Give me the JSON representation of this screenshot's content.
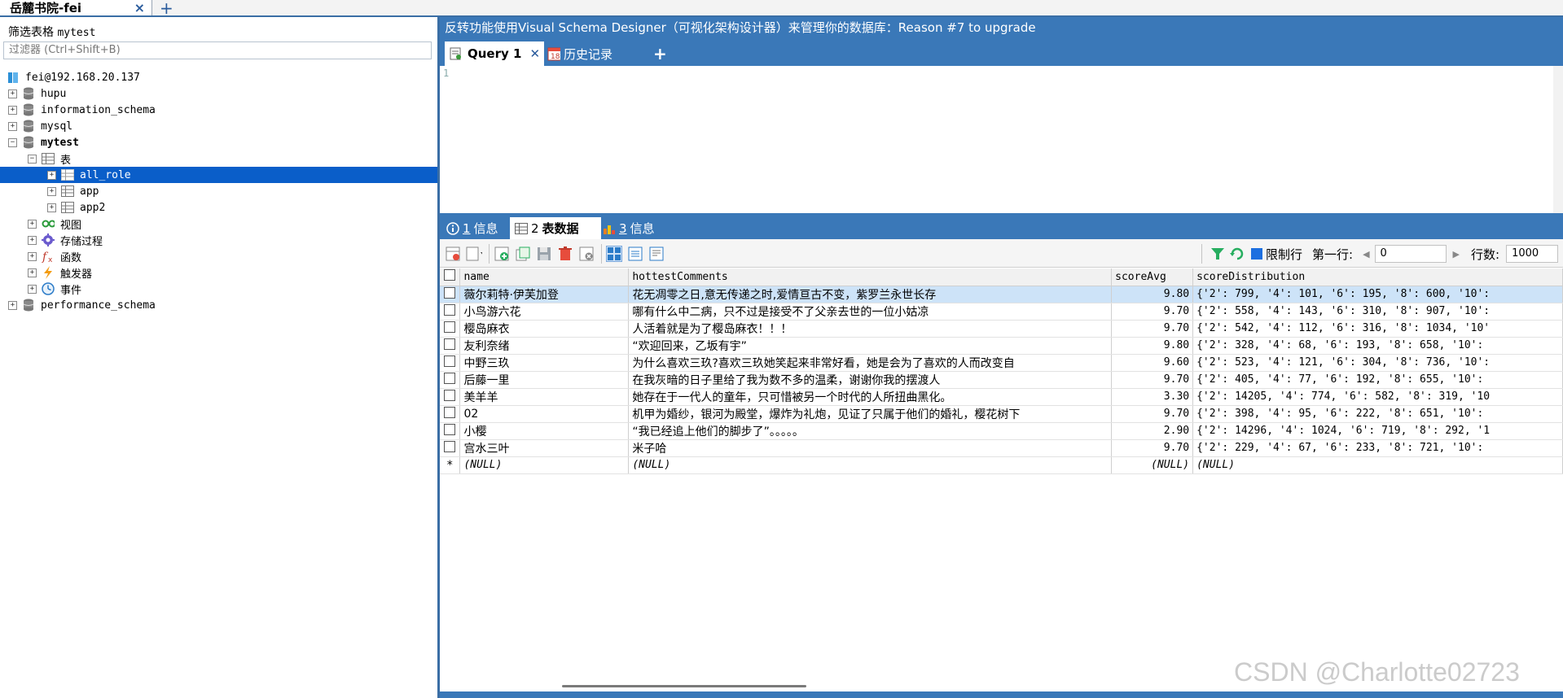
{
  "connection_tab": {
    "title": "岳麓书院-fei",
    "close": "×",
    "add": "+"
  },
  "left": {
    "filter_label": "筛选表格",
    "filter_db": "mytest",
    "filter_placeholder": "过滤器 (Ctrl+Shift+B)",
    "tree": {
      "connection": "fei@192.168.20.137",
      "databases": [
        "hupu",
        "information_schema",
        "mysql",
        "mytest",
        "performance_schema"
      ],
      "tables_folder": "表",
      "tables": [
        "all_role",
        "app",
        "app2"
      ],
      "views": "视图",
      "procedures": "存储过程",
      "functions": "函数",
      "triggers": "触发器",
      "events": "事件"
    }
  },
  "banner": "反转功能使用Visual Schema Designer（可视化架构设计器）来管理你的数据库：Reason #7 to upgrade",
  "query_tabs": {
    "query": "Query 1",
    "history": "历史记录",
    "add": "+"
  },
  "editor": {
    "line_number": "1"
  },
  "result_tabs": {
    "info1_num": "1",
    "info1_label": "信息",
    "data_num": "2",
    "data_label": "表数据",
    "info3_num": "3",
    "info3_label": "信息"
  },
  "grid_toolbar": {
    "limit_label": "限制行",
    "first_row_label": "第一行:",
    "first_row_value": "0",
    "rows_label": "行数:",
    "rows_value": "1000"
  },
  "grid": {
    "columns": [
      "name",
      "hottestComments",
      "scoreAvg",
      "scoreDistribution"
    ],
    "rows": [
      [
        "薇尔莉特·伊芙加登",
        "花无凋零之日,意无传递之时,爱情亘古不变，紫罗兰永世长存",
        "9.80",
        "{'2': 799, '4': 101, '6': 195, '8': 600, '10':"
      ],
      [
        "小鸟游六花",
        "哪有什么中二病，只不过是接受不了父亲去世的一位小姑凉",
        "9.70",
        "{'2': 558, '4': 143, '6': 310, '8': 907, '10':"
      ],
      [
        "樱岛麻衣",
        "人活着就是为了樱岛麻衣！！！",
        "9.70",
        "{'2': 542, '4': 112, '6': 316, '8': 1034, '10'"
      ],
      [
        "友利奈绪",
        "“欢迎回来，乙坂有宇”",
        "9.80",
        "{'2': 328, '4': 68, '6': 193, '8': 658, '10':"
      ],
      [
        "中野三玖",
        "为什么喜欢三玖?喜欢三玖她笑起来非常好看，她是会为了喜欢的人而改变自",
        "9.60",
        "{'2': 523, '4': 121, '6': 304, '8': 736, '10':"
      ],
      [
        "后藤一里",
        "在我灰暗的日子里给了我为数不多的温柔，谢谢你我的摆渡人",
        "9.70",
        "{'2': 405, '4': 77, '6': 192, '8': 655, '10':"
      ],
      [
        "美羊羊",
        "她存在于一代人的童年，只可惜被另一个时代的人所扭曲黑化。",
        "3.30",
        "{'2': 14205, '4': 774, '6': 582, '8': 319, '10"
      ],
      [
        "02",
        "机甲为婚纱，银河为殿堂，爆炸为礼炮，见证了只属于他们的婚礼，樱花树下",
        "9.70",
        "{'2': 398, '4': 95, '6': 222, '8': 651, '10':"
      ],
      [
        "小樱",
        "“我已经追上他们的脚步了”。。。。。",
        "2.90",
        "{'2': 14296, '4': 1024, '6': 719, '8': 292, '1"
      ],
      [
        "宫水三叶",
        "米子哈",
        "9.70",
        "{'2': 229, '4': 67, '6': 233, '8': 721, '10':"
      ]
    ],
    "new_row_marker": "*",
    "null_text": "(NULL)"
  },
  "watermark": "CSDN @Charlotte02723",
  "colors": {
    "accent": "#3a78b8",
    "selection": "#0a5ec9",
    "row_selected": "#cde3f8"
  }
}
